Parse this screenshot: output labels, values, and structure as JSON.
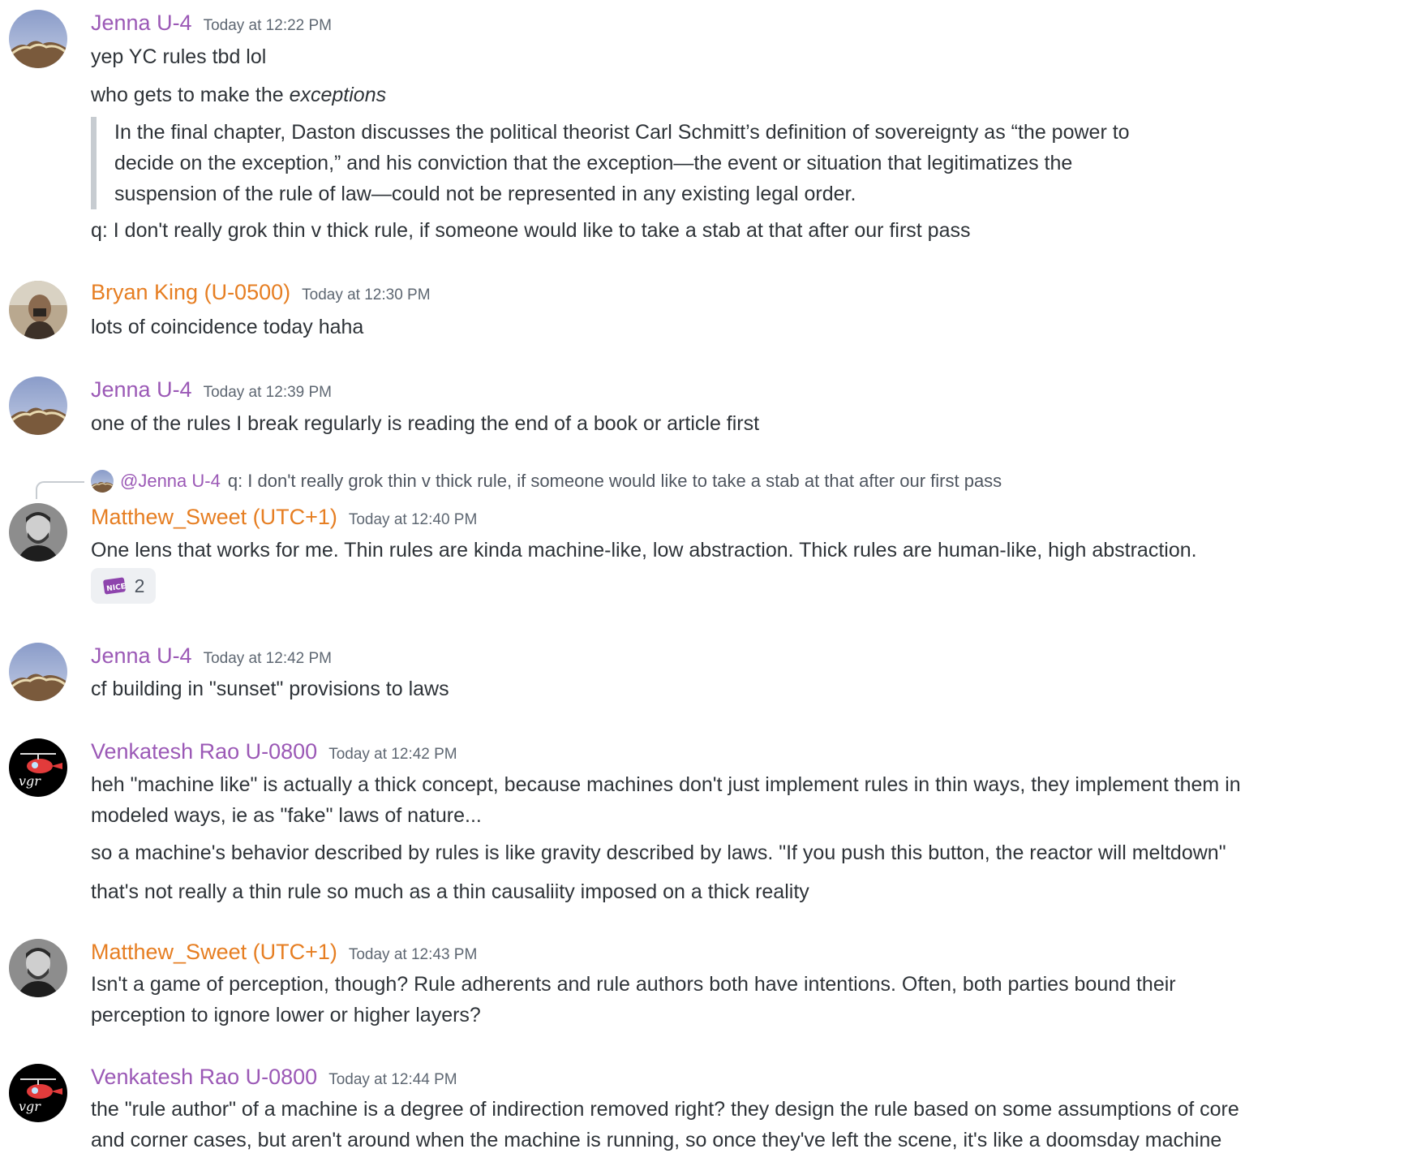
{
  "messages": [
    {
      "author": "Jenna U-4",
      "timestamp": "Today at 12:22 PM",
      "lines": [
        "yep YC rules tbd lol"
      ],
      "line2_prefix": "who gets to make the ",
      "line2_italic": "exceptions",
      "quote": [
        "In the final chapter, Daston discusses the political theorist Carl Schmitt’s definition of sovereignty as “the power to",
        "decide on the exception,” and his conviction that the exception—the event or situation that legitimatizes the",
        "suspension of the rule of law—could not be represented in any existing legal order."
      ],
      "after_quote": "q: I don't really grok thin v thick rule, if someone would like to take a stab at that after our first pass"
    },
    {
      "author": "Bryan King (U-0500)",
      "timestamp": "Today at 12:30 PM",
      "lines": [
        "lots of coincidence today haha"
      ]
    },
    {
      "author": "Jenna U-4",
      "timestamp": "Today at 12:39 PM",
      "lines": [
        "one of the rules I break regularly is reading the end of a book or article first"
      ]
    },
    {
      "reply_to": {
        "mention": "@Jenna U-4",
        "text": "q: I don't really grok thin v thick rule, if someone would like to take a stab at that after our first pass"
      },
      "author": "Matthew_Sweet (UTC+1)",
      "timestamp": "Today at 12:40 PM",
      "lines": [
        "One lens that works for me. Thin rules are kinda machine-like, low abstraction. Thick rules are human-like, high abstraction."
      ],
      "reaction": {
        "emoji": "nice-emoji-icon",
        "count": "2"
      }
    },
    {
      "author": "Jenna U-4",
      "timestamp": "Today at 12:42 PM",
      "lines": [
        "cf building in \"sunset\" provisions to laws"
      ]
    },
    {
      "author": "Venkatesh Rao U-0800",
      "timestamp": "Today at 12:42 PM",
      "lines": [
        "heh \"machine like\" is actually a thick concept, because machines don't just implement rules in thin ways, they implement them in",
        "modeled ways, ie as \"fake\" laws of nature...",
        "so a machine's behavior described by rules is like gravity described by laws. \"If you push this button, the reactor will meltdown\"",
        "that's not really a thin rule so much as a thin causaliity imposed on a thick reality"
      ]
    },
    {
      "author": "Matthew_Sweet (UTC+1)",
      "timestamp": "Today at 12:43 PM",
      "lines": [
        "Isn't a game of perception, though? Rule adherents and rule authors both have intentions. Often, both parties bound their",
        "perception to ignore lower or higher layers?"
      ]
    },
    {
      "author": "Venkatesh Rao U-0800",
      "timestamp": "Today at 12:44 PM",
      "lines": [
        "the \"rule author\" of a machine is a degree of indirection removed right? they design the rule based on some assumptions of core",
        "and corner cases, but aren't around when the machine is running, so once they've left the scene, it's like a doomsday machine"
      ]
    }
  ],
  "colors": {
    "author_purple": "#9b59b6",
    "author_orange": "#e67e22",
    "text": "#2e3338",
    "timestamp": "#5e6772",
    "quote_bar": "#c7ccd1"
  }
}
